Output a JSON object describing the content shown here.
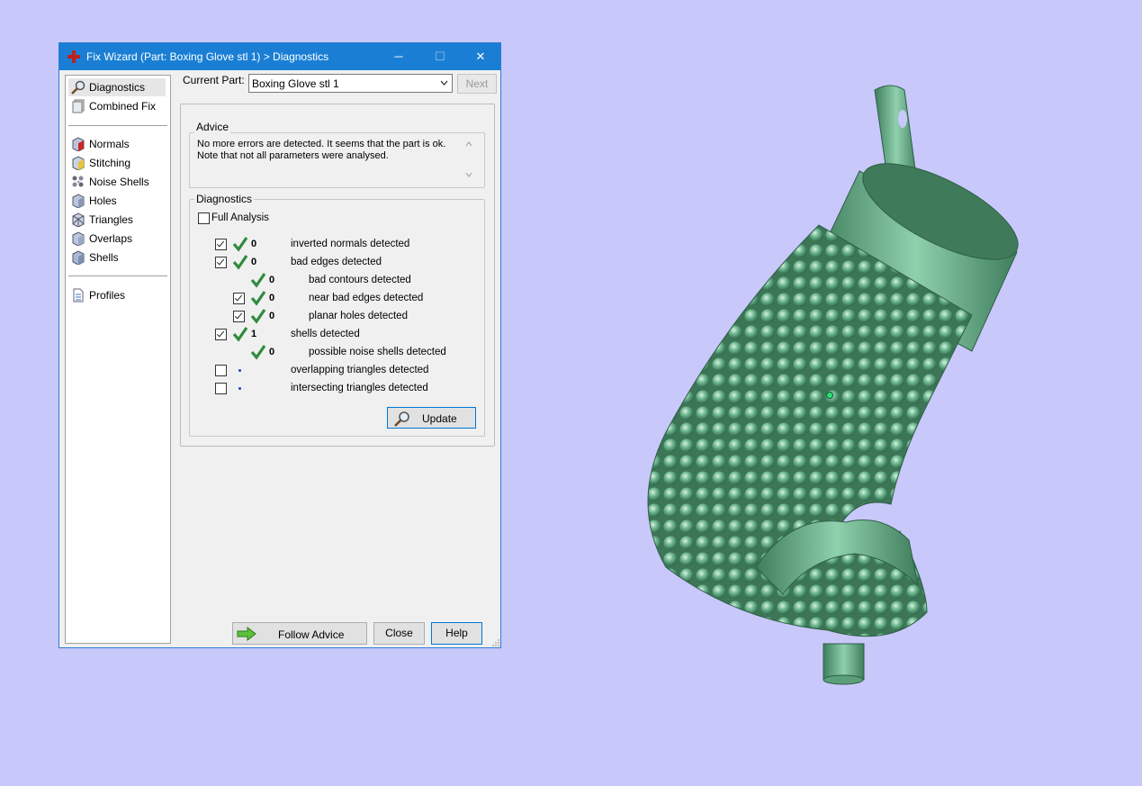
{
  "window": {
    "title": "Fix Wizard (Part: Boxing Glove stl 1) > Diagnostics",
    "minimize": "─",
    "maximize": "☐",
    "close": "✕"
  },
  "nav": {
    "items": [
      {
        "label": "Diagnostics"
      },
      {
        "label": "Combined Fix"
      },
      {
        "label": "Normals"
      },
      {
        "label": "Stitching"
      },
      {
        "label": "Noise Shells"
      },
      {
        "label": "Holes"
      },
      {
        "label": "Triangles"
      },
      {
        "label": "Overlaps"
      },
      {
        "label": "Shells"
      },
      {
        "label": "Profiles"
      }
    ]
  },
  "part": {
    "label": "Current Part:",
    "value": "Boxing Glove stl 1",
    "next": "Next"
  },
  "advice": {
    "title": "Advice",
    "line1": "No more errors are detected. It seems that the part is ok.",
    "line2": "Note that not all parameters were analysed."
  },
  "diagnostics": {
    "title": "Diagnostics",
    "full_analysis": "Full Analysis",
    "rows": [
      {
        "count": "0",
        "text": "inverted normals detected"
      },
      {
        "count": "0",
        "text": "bad edges detected"
      },
      {
        "count": "0",
        "text": "bad contours detected"
      },
      {
        "count": "0",
        "text": "near bad edges detected"
      },
      {
        "count": "0",
        "text": "planar holes detected"
      },
      {
        "count": "1",
        "text": "shells detected"
      },
      {
        "count": "0",
        "text": "possible noise shells detected"
      },
      {
        "count": "",
        "text": "overlapping triangles detected"
      },
      {
        "count": "",
        "text": "intersecting triangles detected"
      }
    ],
    "update": "Update"
  },
  "footer": {
    "follow_advice": "Follow Advice",
    "close": "Close",
    "help": "Help"
  },
  "colors": {
    "background": "#c8c8fa",
    "titlebar": "#1a7fd4",
    "check_green": "#2e8b3e",
    "model_green": "#6fb890"
  }
}
